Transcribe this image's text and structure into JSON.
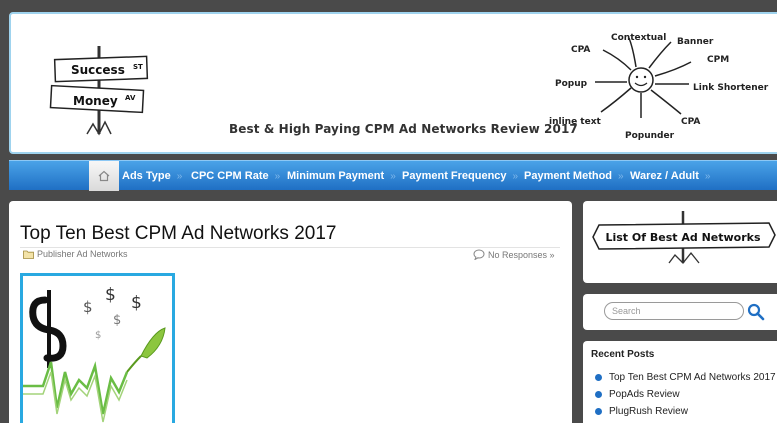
{
  "header": {
    "logo": {
      "sign_top": "Success",
      "sign_top_sup": "ST",
      "sign_bottom": "Money",
      "sign_bottom_sup": "AV"
    },
    "tagline": "Best & High Paying CPM Ad Networks Review 2017",
    "diagram_labels": {
      "contextual": "Contextual",
      "banner": "Banner",
      "cpa_top": "CPA",
      "cpm": "CPM",
      "popup": "Popup",
      "link_shortener": "Link Shortener",
      "inline_text": "inline text",
      "popunder": "Popunder",
      "cpa_bottom": "CPA"
    }
  },
  "nav": {
    "items": [
      {
        "label": "Ads Type"
      },
      {
        "label": "CPC CPM Rate"
      },
      {
        "label": "Minimum Payment"
      },
      {
        "label": "Payment Frequency"
      },
      {
        "label": "Payment Method"
      },
      {
        "label": "Warez / Adult"
      }
    ]
  },
  "post": {
    "title": "Top Ten Best CPM Ad Networks 2017",
    "category": "Publisher Ad Networks",
    "responses": "No Responses »"
  },
  "sidebar": {
    "banner_text": "List Of Best Ad Networks",
    "search_placeholder": "Search",
    "recent_title": "Recent Posts",
    "recent_posts": [
      "Top Ten Best CPM Ad Networks 2017",
      "PopAds Review",
      "PlugRush Review"
    ]
  },
  "colors": {
    "nav_blue": "#1f6fc4",
    "accent_border": "#29a9e1",
    "page_bg": "#4a4a4a"
  }
}
